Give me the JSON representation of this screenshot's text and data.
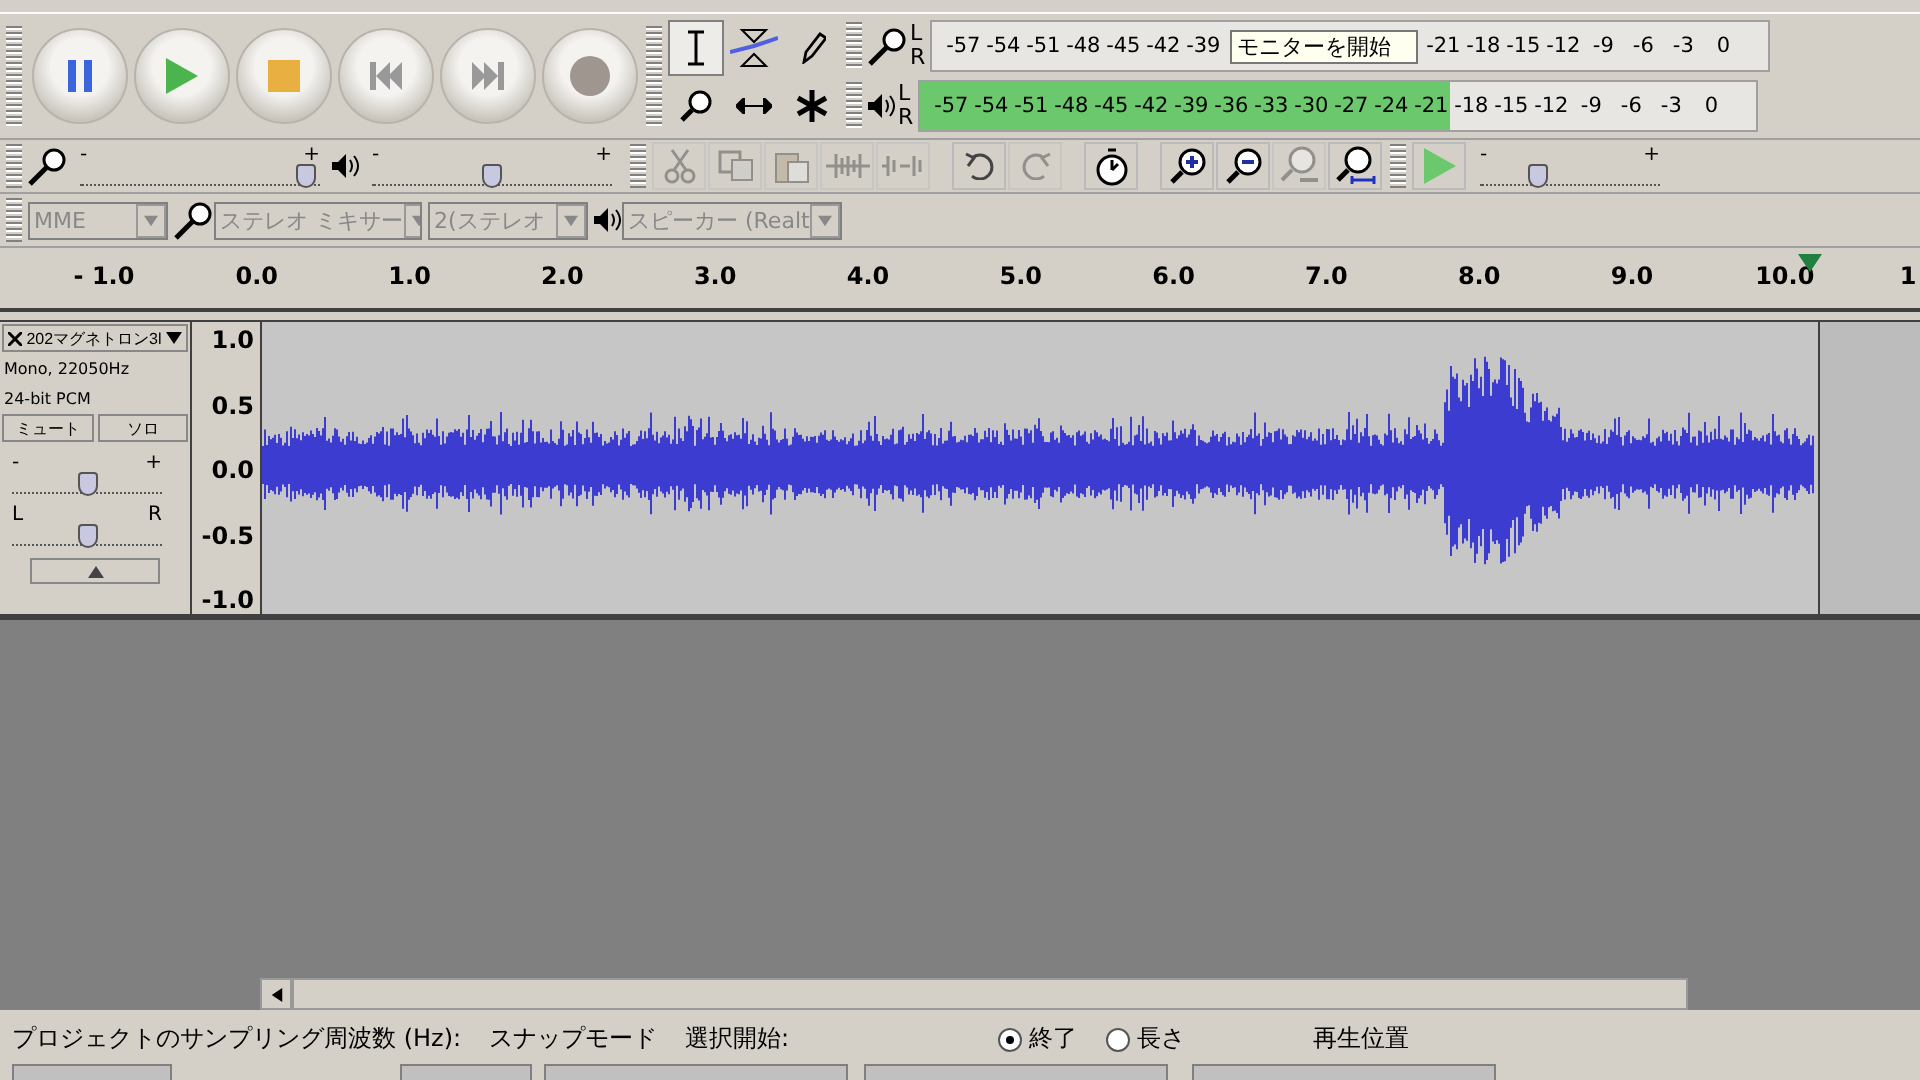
{
  "transport": [
    {
      "kind": "pause",
      "disabled": false
    },
    {
      "kind": "play",
      "disabled": false
    },
    {
      "kind": "stop",
      "disabled": false
    },
    {
      "kind": "skip-start",
      "disabled": true
    },
    {
      "kind": "skip-end",
      "disabled": true
    },
    {
      "kind": "record",
      "disabled": true
    }
  ],
  "tools": [
    {
      "kind": "select",
      "selected": true
    },
    {
      "kind": "envelope",
      "selected": false
    },
    {
      "kind": "draw",
      "selected": false
    },
    {
      "kind": "zoom",
      "selected": false
    },
    {
      "kind": "timeshift",
      "selected": false
    },
    {
      "kind": "multi",
      "selected": false
    }
  ],
  "meters": [
    {
      "kind": "record",
      "channels": [
        "L",
        "R"
      ],
      "labels_before": [
        "-57",
        "-54",
        "-51",
        "-48",
        "-45",
        "-42",
        "-39"
      ],
      "tooltip": "モニターを開始",
      "labels_after": [
        "-21",
        "-18",
        "-15",
        "-12",
        "-9",
        "-6",
        "-3",
        "0"
      ]
    },
    {
      "kind": "play",
      "channels": [
        "L",
        "R"
      ],
      "labels_before": [
        "-57",
        "-54",
        "-51",
        "-48",
        "-45",
        "-42",
        "-39",
        "-36",
        "-33",
        "-30",
        "-27",
        "-24",
        "-21",
        "-18",
        "-15",
        "-12",
        "-9",
        "-6",
        "-3",
        "0"
      ],
      "level": 0.635
    }
  ],
  "mixer": [
    {
      "kind": "mic",
      "min_label": "-",
      "max_label": "+",
      "level": 0.94
    },
    {
      "kind": "speaker",
      "min_label": "-",
      "max_label": "+",
      "level": 0.5
    }
  ],
  "edit_tools": [
    {
      "kind": "cut",
      "disabled": true
    },
    {
      "kind": "copy",
      "disabled": true
    },
    {
      "kind": "paste",
      "disabled": true
    },
    {
      "kind": "trim",
      "disabled": true
    },
    {
      "kind": "silence",
      "disabled": true
    },
    {
      "kind": "undo",
      "disabled": false
    },
    {
      "kind": "redo",
      "disabled": true
    },
    {
      "kind": "timer",
      "disabled": false
    },
    {
      "kind": "zoom-in",
      "disabled": false
    },
    {
      "kind": "zoom-out",
      "disabled": false
    },
    {
      "kind": "fit-selection",
      "disabled": true
    },
    {
      "kind": "fit-project",
      "disabled": false
    }
  ],
  "play_at_speed": {
    "min_label": "-",
    "max_label": "+",
    "level": 0.32
  },
  "devices": [
    {
      "kind": "host",
      "value": "MME"
    },
    {
      "kind": "mic",
      "value": "ステレオ ミキサー"
    },
    {
      "kind": "channels",
      "value": "2(ステレオ"
    },
    {
      "kind": "speaker",
      "value": "スピーカー (Realt"
    }
  ],
  "ruler": {
    "labels": [
      "- 1.0",
      "0.0",
      "1.0",
      "2.0",
      "3.0",
      "4.0",
      "5.0",
      "6.0",
      "7.0",
      "8.0",
      "9.0",
      "10.0",
      "1"
    ]
  },
  "track": {
    "name": "202マグネトロン3l",
    "format": "Mono, 22050Hz",
    "bit_depth": "24-bit PCM",
    "buttons": [
      "ミュート",
      "ソロ"
    ],
    "gain": {
      "min_label": "-",
      "max_label": "+",
      "level": 0.5
    },
    "pan": {
      "min_label": "L",
      "max_label": "R",
      "level": 0.5
    },
    "scale": [
      "1.0",
      "0.5",
      "0.0",
      "-0.5",
      "-1.0"
    ]
  },
  "selection_bar": {
    "rate_label": "プロジェクトのサンプリング周波数 (Hz):",
    "snap_label": "スナップモード",
    "start_label": "選択開始:",
    "end_options": [
      {
        "label": "終了",
        "selected": true
      },
      {
        "label": "長さ",
        "selected": false
      }
    ],
    "position_label": "再生位置"
  }
}
